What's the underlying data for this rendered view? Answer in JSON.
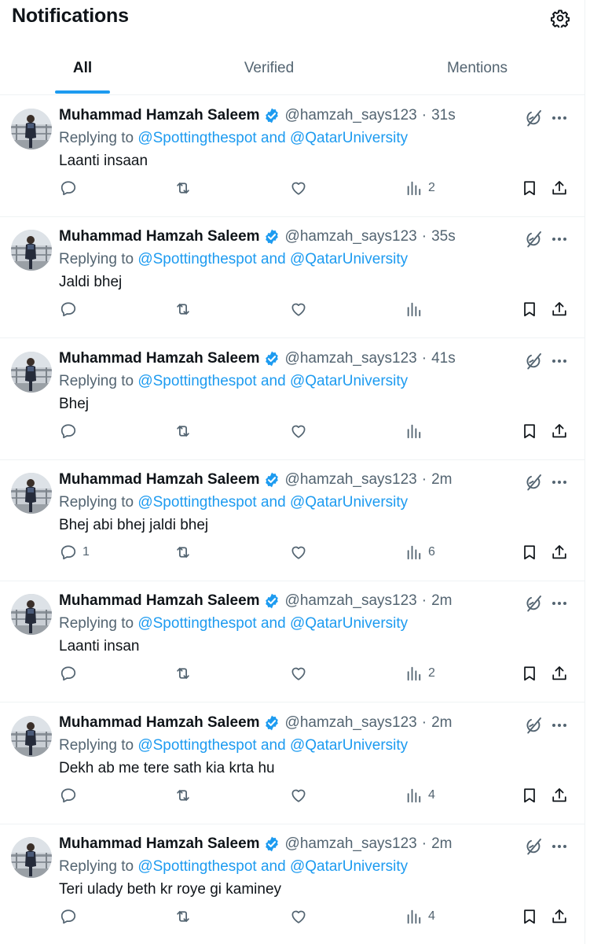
{
  "header": {
    "title": "Notifications",
    "settings_icon": "gear-icon"
  },
  "tabs": [
    {
      "label": "All",
      "active": true
    },
    {
      "label": "Verified",
      "active": false
    },
    {
      "label": "Mentions",
      "active": false
    }
  ],
  "colors": {
    "accent": "#1d9bf0",
    "text_primary": "#0f1419",
    "text_secondary": "#536471",
    "divider": "#eff3f4"
  },
  "icons": {
    "reply": "speech-bubble-icon",
    "retweet": "retweet-arrows-icon",
    "like": "heart-icon",
    "views": "bar-chart-icon",
    "bookmark": "bookmark-icon",
    "share": "share-upload-icon",
    "grok": "grok-slash-circle-icon",
    "more": "ellipsis-icon",
    "verified": "verified-badge-icon"
  },
  "tweets": [
    {
      "name": "Muhammad Hamzah Saleem",
      "handle": "@hamzah_says123",
      "dot": "·",
      "time": "31s",
      "replying_prefix": "Replying to ",
      "mention1": "@Spottingthespot",
      "and": " and ",
      "mention2": "@QatarUniversity",
      "text": "Laanti insaan",
      "replies": "",
      "views": "2"
    },
    {
      "name": "Muhammad Hamzah Saleem",
      "handle": "@hamzah_says123",
      "dot": "·",
      "time": "35s",
      "replying_prefix": "Replying to ",
      "mention1": "@Spottingthespot",
      "and": " and ",
      "mention2": "@QatarUniversity",
      "text": "Jaldi bhej",
      "replies": "",
      "views": ""
    },
    {
      "name": "Muhammad Hamzah Saleem",
      "handle": "@hamzah_says123",
      "dot": "·",
      "time": "41s",
      "replying_prefix": "Replying to ",
      "mention1": "@Spottingthespot",
      "and": " and ",
      "mention2": "@QatarUniversity",
      "text": "Bhej",
      "replies": "",
      "views": ""
    },
    {
      "name": "Muhammad Hamzah Saleem",
      "handle": "@hamzah_says123",
      "dot": "·",
      "time": "2m",
      "replying_prefix": "Replying to ",
      "mention1": "@Spottingthespot",
      "and": " and ",
      "mention2": "@QatarUniversity",
      "text": "Bhej abi bhej jaldi bhej",
      "replies": "1",
      "views": "6"
    },
    {
      "name": "Muhammad Hamzah Saleem",
      "handle": "@hamzah_says123",
      "dot": "·",
      "time": "2m",
      "replying_prefix": "Replying to ",
      "mention1": "@Spottingthespot",
      "and": " and ",
      "mention2": "@QatarUniversity",
      "text": "Laanti insan",
      "replies": "",
      "views": "2"
    },
    {
      "name": "Muhammad Hamzah Saleem",
      "handle": "@hamzah_says123",
      "dot": "·",
      "time": "2m",
      "replying_prefix": "Replying to ",
      "mention1": "@Spottingthespot",
      "and": " and ",
      "mention2": "@QatarUniversity",
      "text": "Dekh ab me tere sath kia krta hu",
      "replies": "",
      "views": "4"
    },
    {
      "name": "Muhammad Hamzah Saleem",
      "handle": "@hamzah_says123",
      "dot": "·",
      "time": "2m",
      "replying_prefix": "Replying to ",
      "mention1": "@Spottingthespot",
      "and": " and ",
      "mention2": "@QatarUniversity",
      "text": "Teri ulady beth kr roye gi kaminey",
      "replies": "",
      "views": "4"
    }
  ]
}
